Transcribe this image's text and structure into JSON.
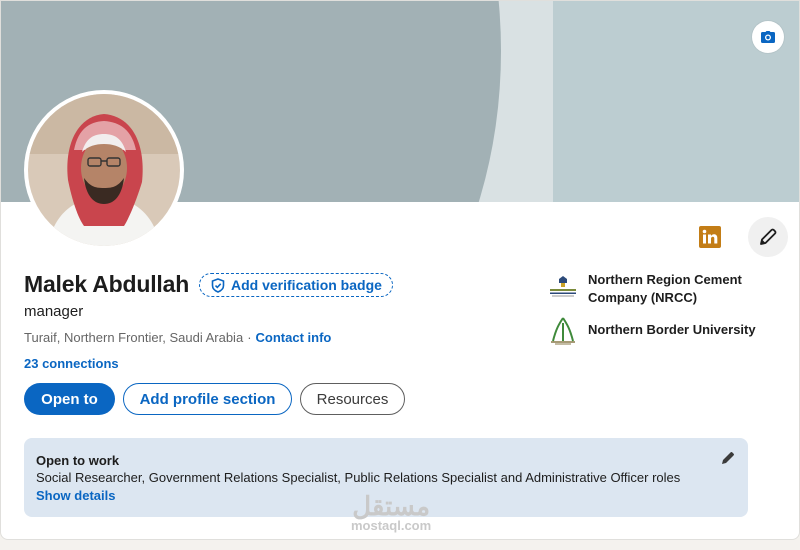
{
  "profile": {
    "name": "Malek Abdullah",
    "verification_badge_label": "Add verification badge",
    "headline": "manager",
    "location": "Turaif, Northern Frontier, Saudi Arabia",
    "location_separator": "·",
    "contact_info_label": "Contact info",
    "connections": "23 connections"
  },
  "actions": {
    "open_to_label": "Open to",
    "add_section_label": "Add profile section",
    "resources_label": "Resources"
  },
  "organizations": [
    {
      "name": "Northern Region Cement Company (NRCC)",
      "logo_icon": "nrcc-logo-icon"
    },
    {
      "name": "Northern Border University",
      "logo_icon": "nbu-logo-icon"
    }
  ],
  "open_to_work": {
    "title": "Open to work",
    "roles": "Social Researcher, Government Relations Specialist, Public Relations Specialist and Administrative Officer roles",
    "show_details_label": "Show details"
  },
  "watermark": {
    "arabic": "مستقل",
    "latin": "mostaql.com"
  },
  "icons": {
    "cover_camera": "camera-icon",
    "linkedin": "linkedin-icon",
    "edit": "pencil-icon",
    "verify": "shield-check-icon"
  },
  "colors": {
    "accent": "#0a66c2",
    "linkedin_badge": "#c37d16",
    "open_to_work_bg": "#dce6f1"
  }
}
